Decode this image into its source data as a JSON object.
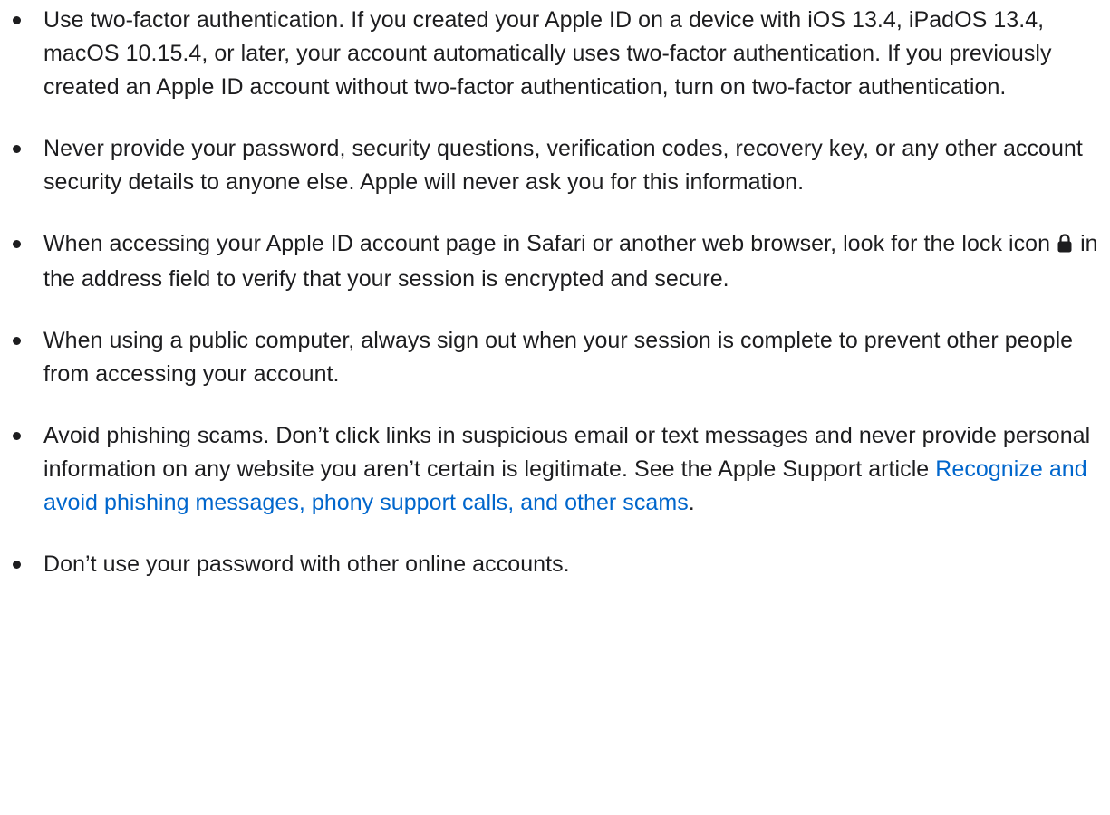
{
  "tips": [
    {
      "text": "Use two-factor authentication. If you created your Apple ID on a device with iOS 13.4, iPadOS 13.4, macOS 10.15.4, or later, your account automatically uses two-factor authentication. If you previously created an Apple ID account without two-factor authentication, turn on two-factor authentication."
    },
    {
      "text": "Never provide your password, security questions, verification codes, recovery key, or any other account security details to anyone else. Apple will never ask you for this information."
    },
    {
      "text_before_icon": "When accessing your Apple ID account page in Safari or another web browser, look for the lock icon",
      "icon": "lock-icon",
      "text_after_icon": " in the address field to verify that your session is encrypted and secure."
    },
    {
      "text": "When using a public computer, always sign out when your session is complete to prevent other people from accessing your account."
    },
    {
      "text_before_link": "Avoid phishing scams. Don’t click links in suspicious email or text messages and never provide personal information on any website you aren’t certain is legitimate. See the Apple Support article ",
      "link_text": "Recognize and avoid phishing messages, phony support calls, and other scams",
      "text_after_link": "."
    },
    {
      "text": "Don’t use your password with other online accounts."
    }
  ],
  "colors": {
    "text": "#1d1d1f",
    "link": "#0066cc",
    "background": "#ffffff"
  }
}
